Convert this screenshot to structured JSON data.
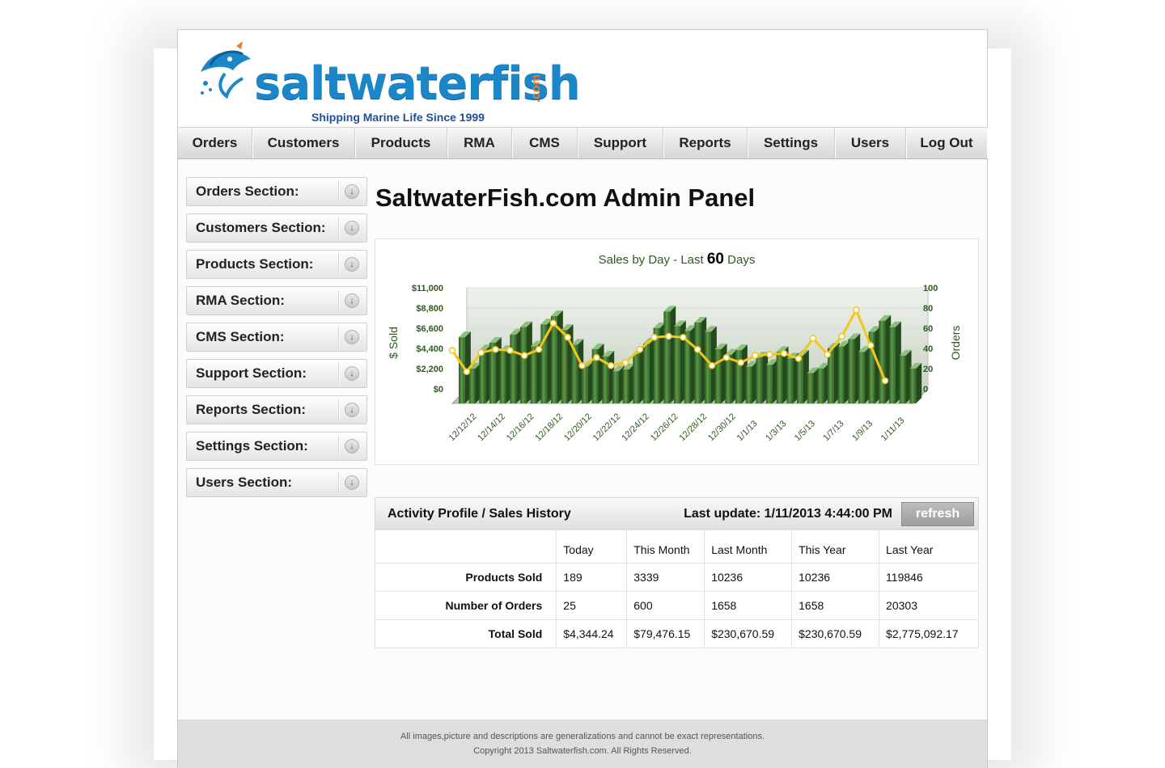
{
  "brand": {
    "logo_text": "saltwaterfish",
    "logo_suffix": ".com",
    "tagline": "Shipping Marine Life Since 1999",
    "colors": {
      "primary": "#1b87c8",
      "accent": "#e97d2a",
      "tagline": "#1f4f96"
    }
  },
  "nav": {
    "items": [
      {
        "label": "Orders",
        "width": 92
      },
      {
        "label": "Customers",
        "width": 127
      },
      {
        "label": "Products",
        "width": 114
      },
      {
        "label": "RMA",
        "width": 80
      },
      {
        "label": "CMS",
        "width": 81
      },
      {
        "label": "Support",
        "width": 106
      },
      {
        "label": "Reports",
        "width": 104
      },
      {
        "label": "Settings",
        "width": 108
      },
      {
        "label": "Users",
        "width": 88
      },
      {
        "label": "Log Out",
        "width": 100
      }
    ]
  },
  "sidebar": {
    "items": [
      {
        "label": "Orders Section:"
      },
      {
        "label": "Customers Section:"
      },
      {
        "label": "Products Section:"
      },
      {
        "label": "RMA Section:"
      },
      {
        "label": "CMS Section:"
      },
      {
        "label": "Support Section:"
      },
      {
        "label": "Reports Section:"
      },
      {
        "label": "Settings Section:"
      },
      {
        "label": "Users Section:"
      }
    ],
    "arrow_icon": "circle-arrow-down-icon"
  },
  "main": {
    "title": "SaltwaterFish.com Admin Panel"
  },
  "chart_data": {
    "type": "bar",
    "title_prefix": "Sales by Day - Last",
    "title_number": "60",
    "title_suffix": "Days",
    "ylabel": "$ Sold",
    "y2label": "Orders",
    "yticks": [
      "$11,000",
      "$8,800",
      "$6,600",
      "$4,400",
      "$2,200",
      "$0"
    ],
    "y2ticks": [
      "100",
      "80",
      "60",
      "40",
      "20",
      "0"
    ],
    "ylim": [
      0,
      11000
    ],
    "y2lim": [
      0,
      100
    ],
    "x_tick_labels": [
      "12/12/12",
      "12/14/12",
      "12/16/12",
      "12/18/12",
      "12/20/12",
      "12/22/12",
      "12/24/12",
      "12/26/12",
      "12/28/12",
      "12/30/12",
      "1/1/13",
      "1/3/13",
      "1/5/13",
      "1/7/13",
      "1/9/13",
      "1/11/13"
    ],
    "bar_color": "#3f7a31",
    "line_color": "#f2c61a",
    "bars_sold": [
      7200,
      3800,
      5800,
      6600,
      5700,
      7500,
      8300,
      6200,
      8600,
      9500,
      8000,
      6400,
      4000,
      5900,
      5100,
      3500,
      3700,
      5400,
      6500,
      8200,
      10000,
      8400,
      7900,
      8800,
      7800,
      5900,
      5300,
      5800,
      4000,
      5000,
      4200,
      5600,
      4900,
      5200,
      3300,
      3800,
      6000,
      6200,
      7000,
      5600,
      7800,
      9000,
      8300,
      5200,
      3800
    ],
    "orders": [
      38,
      17,
      36,
      39,
      38,
      33,
      39,
      65,
      51,
      23,
      31,
      23,
      26,
      39,
      51,
      52,
      51,
      39,
      23,
      31,
      26,
      33,
      34,
      35,
      30,
      50,
      34,
      52,
      78,
      43,
      8
    ]
  },
  "activity": {
    "title": "Activity Profile / Sales History",
    "last_update": "Last update: 1/11/2013  4:44:00 PM",
    "refresh_label": "refresh",
    "columns": [
      "",
      "Today",
      "This Month",
      "Last Month",
      "This Year",
      "Last Year"
    ],
    "rows": [
      {
        "label": "Products Sold",
        "values": [
          "189",
          "3339",
          "10236",
          "10236",
          "119846"
        ]
      },
      {
        "label": "Number of Orders",
        "values": [
          "25",
          "600",
          "1658",
          "1658",
          "20303"
        ]
      },
      {
        "label": "Total Sold",
        "values": [
          "$4,344.24",
          "$79,476.15",
          "$230,670.59",
          "$230,670.59",
          "$2,775,092.17"
        ]
      }
    ]
  },
  "footer": {
    "line1": "All images,picture and descriptions are generalizations and cannot be exact representations.",
    "line2": "Copyright 2013 Saltwaterfish.com. All Rights Reserved."
  }
}
